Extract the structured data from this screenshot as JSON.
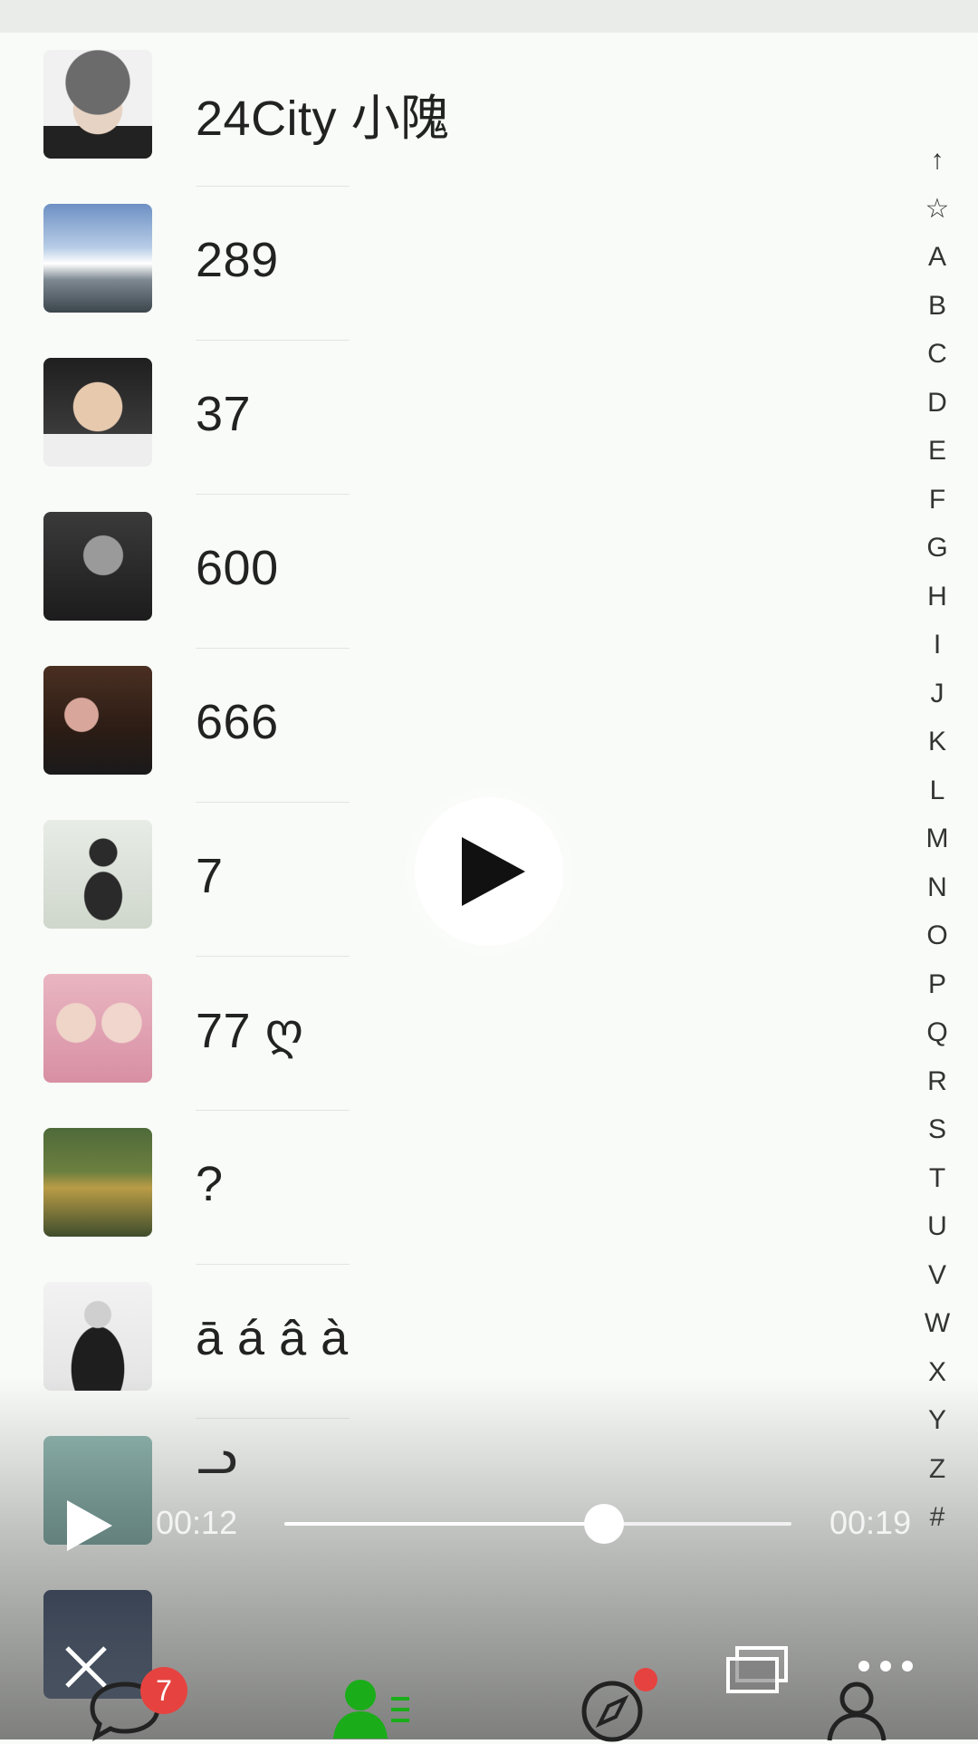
{
  "contacts": [
    {
      "name": "24City   小隗"
    },
    {
      "name": "289"
    },
    {
      "name": "37"
    },
    {
      "name": "600"
    },
    {
      "name": "666"
    },
    {
      "name": "7"
    },
    {
      "name": "77  ღ"
    },
    {
      "name": "?"
    },
    {
      "name": "ā á â à"
    },
    {
      "name": "ᓗ"
    },
    {
      "name": ""
    }
  ],
  "index_letters": [
    "↑",
    "☆",
    "A",
    "B",
    "C",
    "D",
    "E",
    "F",
    "G",
    "H",
    "I",
    "J",
    "K",
    "L",
    "M",
    "N",
    "O",
    "P",
    "Q",
    "R",
    "S",
    "T",
    "U",
    "V",
    "W",
    "X",
    "Y",
    "Z",
    "#"
  ],
  "player": {
    "current_time": "00:12",
    "total_time": "00:19",
    "progress": 0.63
  },
  "tab_bar": {
    "chats_badge": "7",
    "tabs": [
      "chats-icon",
      "contacts-icon",
      "discover-icon",
      "me-icon"
    ]
  },
  "colors": {
    "accent_green": "#1aad19",
    "badge_red": "#e64340"
  }
}
